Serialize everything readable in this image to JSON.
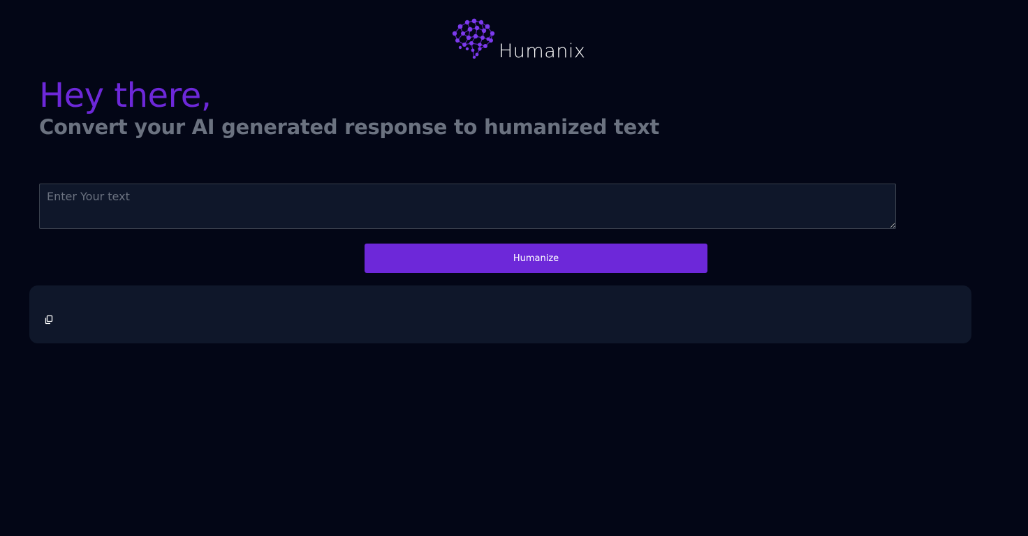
{
  "brand": {
    "name": "Humanix",
    "logo_icon": "brain-network-icon",
    "accent_color": "#6d28d9"
  },
  "hero": {
    "greeting": "Hey there,",
    "subtitle": "Convert your AI generated response to humanized text"
  },
  "input": {
    "value": "",
    "placeholder": "Enter Your text"
  },
  "actions": {
    "humanize_label": "Humanize"
  },
  "output": {
    "text": "",
    "copy_icon": "copy-icon"
  },
  "colors": {
    "background": "#030616",
    "panel": "#0f172a",
    "muted_text": "#6b7280"
  }
}
